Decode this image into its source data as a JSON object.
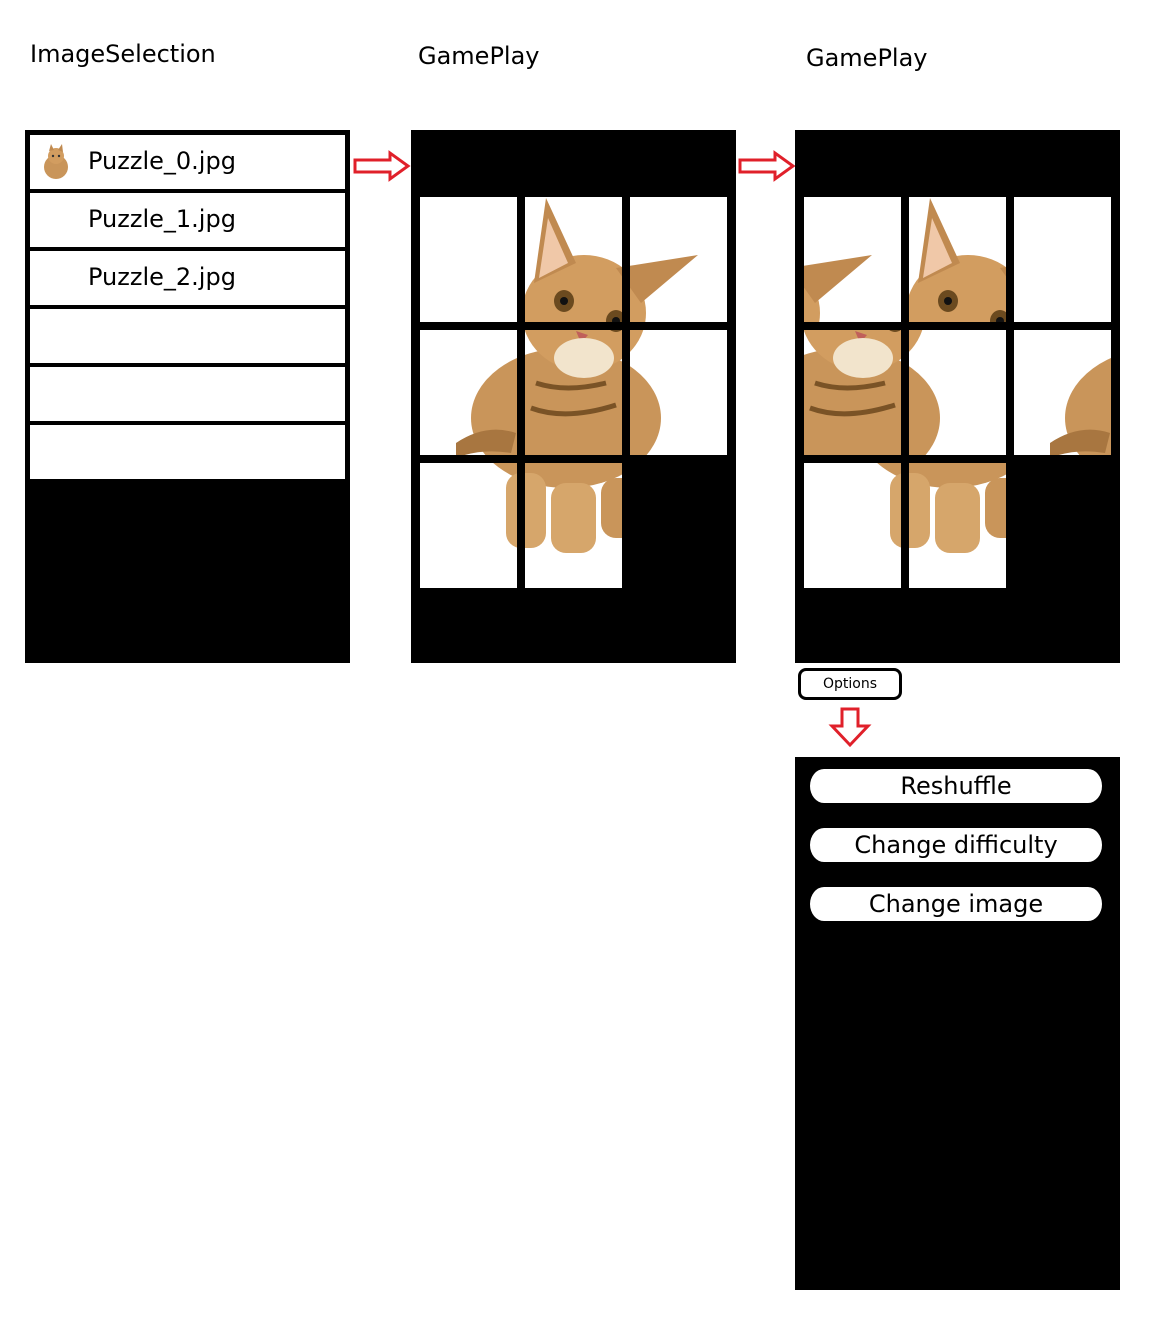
{
  "titles": {
    "screen1": "ImageSelection",
    "screen2": "GamePlay",
    "screen3": "GamePlay"
  },
  "image_selection": {
    "items": [
      {
        "label": "Puzzle_0.jpg",
        "thumbnail": "kitten-thumbnail"
      },
      {
        "label": "Puzzle_1.jpg"
      },
      {
        "label": "Puzzle_2.jpg"
      },
      {
        "label": ""
      },
      {
        "label": ""
      },
      {
        "label": ""
      }
    ]
  },
  "gameplay": {
    "grid": "3x3",
    "image": "kitten"
  },
  "options": {
    "button_label": "Options",
    "menu": [
      "Reshuffle",
      "Change difficulty",
      "Change image"
    ]
  },
  "colors": {
    "arrow": "#e0202a",
    "screen_bg": "#000000"
  }
}
